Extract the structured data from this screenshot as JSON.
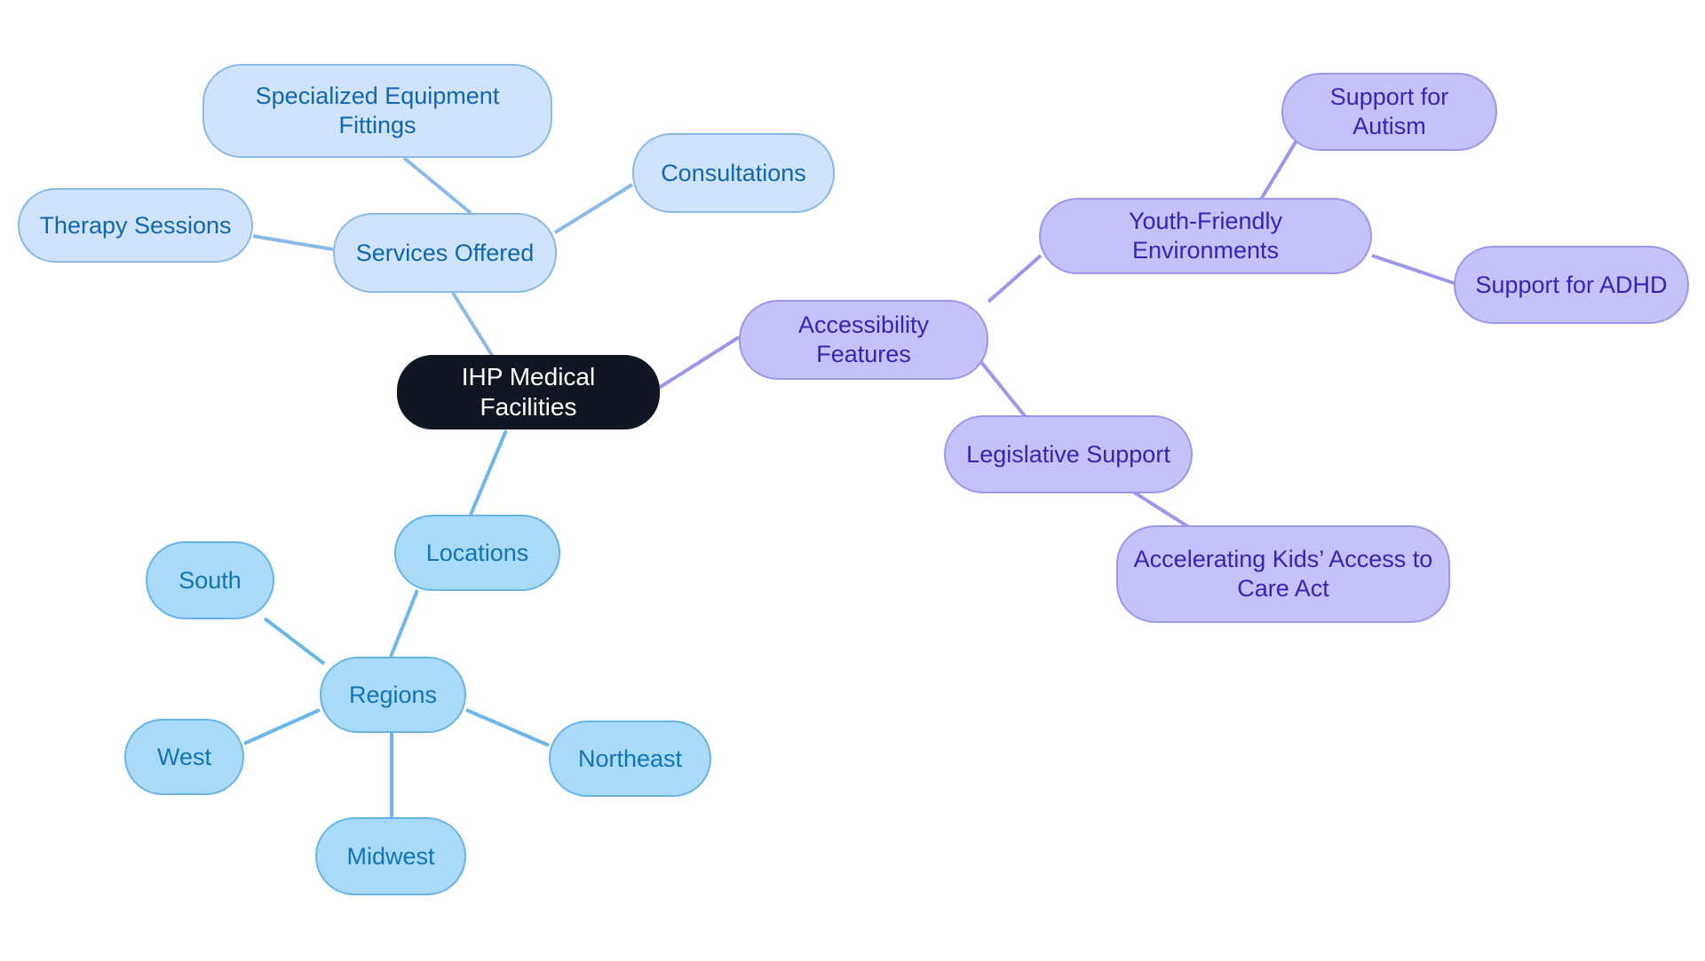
{
  "diagram": {
    "type": "mindmap",
    "title": "IHP Medical Facilities",
    "background": "#ffffff",
    "palette": {
      "root_fill": "#101723",
      "root_text": "#ffffff",
      "blue_fill": "#cfe4fb",
      "blue_border": "#8cb9e6",
      "blue_text": "#1266b0",
      "cyan_fill": "#a9daf8",
      "cyan_border": "#69b4e6",
      "cyan_text": "#1174b5",
      "purple_fill": "#c4c2f8",
      "purple_border": "#9b98e8",
      "purple_text": "#3426b5",
      "edge_blue": "#8cb9e6",
      "edge_cyan": "#6cb6e8",
      "edge_purple": "#9b98e8"
    }
  },
  "nodes": {
    "root": {
      "label": "IHP Medical Facilities"
    },
    "services_offered": {
      "label": "Services Offered"
    },
    "specialized_equipment_fittings": {
      "label": "Specialized Equipment Fittings"
    },
    "consultations": {
      "label": "Consultations"
    },
    "therapy_sessions": {
      "label": "Therapy Sessions"
    },
    "locations": {
      "label": "Locations"
    },
    "regions": {
      "label": "Regions"
    },
    "south": {
      "label": "South"
    },
    "west": {
      "label": "West"
    },
    "midwest": {
      "label": "Midwest"
    },
    "northeast": {
      "label": "Northeast"
    },
    "accessibility_features": {
      "label": "Accessibility Features"
    },
    "youth_friendly_environments": {
      "label": "Youth-Friendly Environments"
    },
    "support_for_autism": {
      "label": "Support for Autism"
    },
    "support_for_adhd": {
      "label": "Support for ADHD"
    },
    "legislative_support": {
      "label": "Legislative Support"
    },
    "accelerating_kids_act": {
      "label": "Accelerating Kids’ Access to\nCare Act"
    }
  }
}
